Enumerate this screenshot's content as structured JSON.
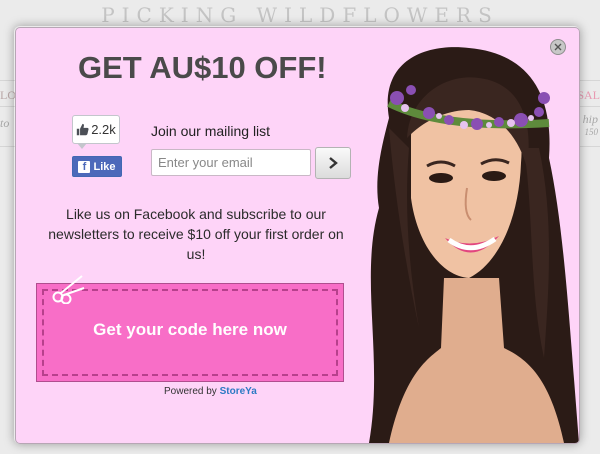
{
  "site": {
    "title": "PICKING WILDFLOWERS",
    "nav_left": "LO",
    "nav_right": "SAL",
    "promo_left": "to",
    "promo_right": "hip",
    "promo_right_small": "150"
  },
  "popup": {
    "headline": "GET AU$10 OFF!",
    "facebook": {
      "like_count": "2.2k",
      "like_label": "Like"
    },
    "mailing": {
      "label": "Join our mailing list",
      "email_placeholder": "Enter your email",
      "email_value": ""
    },
    "body_text": "Like us on Facebook and subscribe to our newsletters to receive $10 off your first order on us!",
    "coupon_label": "Get your code here now",
    "powered_prefix": "Powered by",
    "powered_brand": "StoreYa",
    "colors": {
      "popup_bg": "#fed4f8",
      "coupon_bg": "#f86ec7",
      "facebook_blue": "#4c69ba",
      "brand_blue": "#2d7ac4"
    },
    "icons": [
      "close-icon",
      "thumbs-up-icon",
      "facebook-f-icon",
      "chevron-right-icon",
      "scissors-icon"
    ]
  }
}
